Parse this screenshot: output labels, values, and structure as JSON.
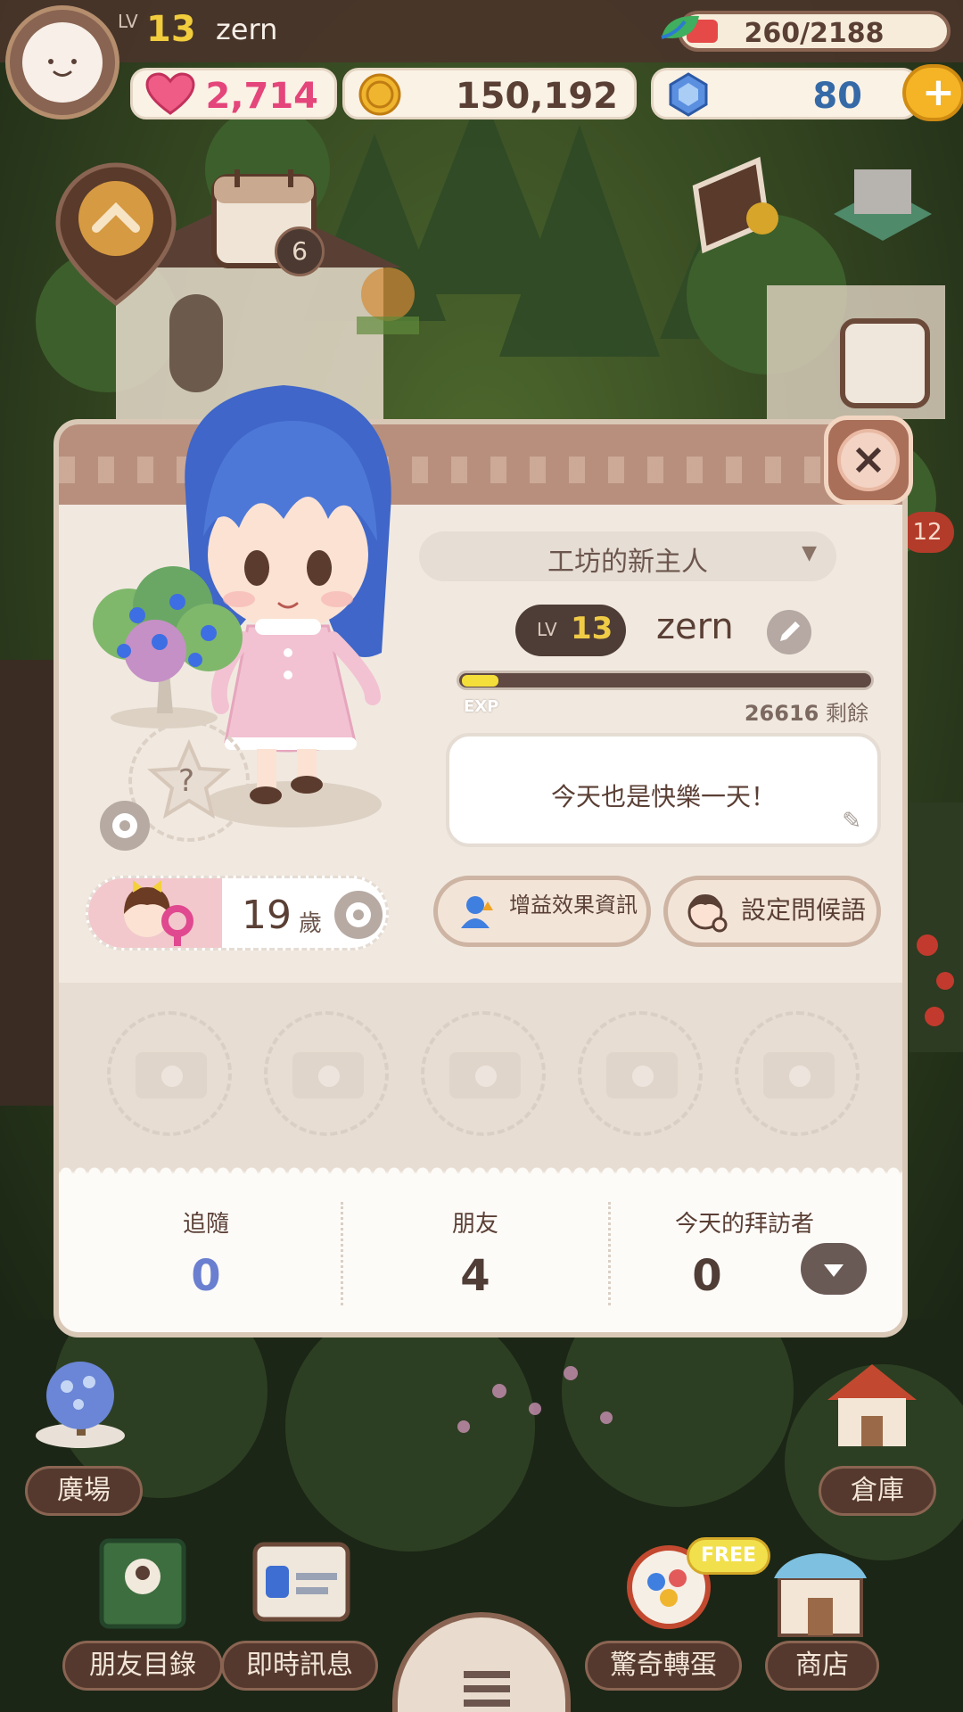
{
  "hud": {
    "level_prefix": "LV",
    "level": "13",
    "username": "zern",
    "energy": "260/2188",
    "energy_fraction": 0.119,
    "hearts": "2,714",
    "coins": "150,192",
    "gems": "80",
    "plus_label": "+"
  },
  "map": {
    "calendar_badge": "6",
    "side_badge": "12"
  },
  "panel": {
    "close_label": "×",
    "title": "工坊的新主人",
    "title_arrow": "▼",
    "level_prefix": "LV",
    "level": "13",
    "name": "zern",
    "exp_label": "EXP",
    "exp_remaining_value": "26616",
    "exp_remaining_suffix": "剩餘",
    "exp_fraction": 0.09,
    "greeting": "今天也是快樂一天！",
    "star_slot_label": "?",
    "age": "19",
    "age_unit": "歲",
    "boost_button": "增益效果資訊",
    "greeting_button": "設定問候語",
    "stats": {
      "follow_label": "追隨",
      "follow_value": "0",
      "friends_label": "朋友",
      "friends_value": "4",
      "visitors_label": "今天的拜訪者",
      "visitors_value": "0"
    }
  },
  "nav": {
    "plaza": "廣場",
    "warehouse": "倉庫",
    "friends_list": "朋友目錄",
    "instant_message": "即時訊息",
    "gacha": "驚奇轉蛋",
    "shop": "商店",
    "free_tag": "FREE"
  },
  "colors": {
    "energy_fill": "#e54a48",
    "exp_fill": "#f4de3a",
    "heart": "#e4457a",
    "gem": "#356aa7",
    "follow_value": "#6b7fd0"
  }
}
